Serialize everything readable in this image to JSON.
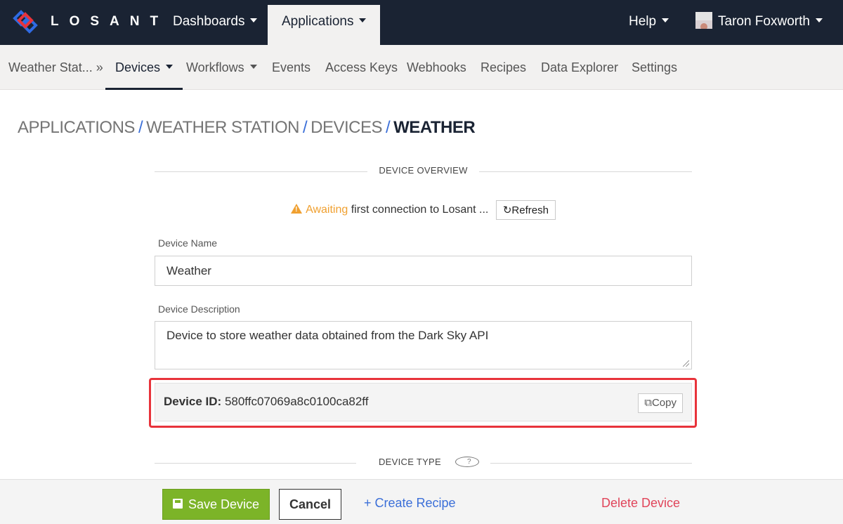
{
  "topbar": {
    "brand": "LOSANT",
    "dashboards": "Dashboards",
    "applications": "Applications",
    "help": "Help",
    "user": "Taron Foxworth"
  },
  "subnav": {
    "app": "Weather Stat... »",
    "devices": "Devices",
    "workflows": "Workflows",
    "events": "Events",
    "access_keys": "Access Keys",
    "webhooks": "Webhooks",
    "recipes": "Recipes",
    "data_explorer": "Data Explorer",
    "settings": "Settings"
  },
  "breadcrumb": {
    "items": [
      "APPLICATIONS",
      "WEATHER STATION",
      "DEVICES"
    ],
    "separator": "/",
    "current": "WEATHER"
  },
  "overview": {
    "heading": "DEVICE OVERVIEW",
    "status_highlight": "Awaiting",
    "status_rest": " first connection to Losant ...",
    "refresh_label": "Refresh"
  },
  "form": {
    "name_label": "Device Name",
    "name_value": "Weather",
    "description_label": "Device Description",
    "description_value": "Device to store weather data obtained from the Dark Sky API",
    "device_id_label": "Device ID:",
    "device_id_value": "580ffc07069a8c0100ca82ff",
    "copy_label": "Copy"
  },
  "device_type": {
    "heading": "DEVICE TYPE",
    "help": "?"
  },
  "footer": {
    "save": "Save Device",
    "cancel": "Cancel",
    "create_recipe": "+ Create Recipe",
    "delete": "Delete Device"
  },
  "colors": {
    "nav_bg": "#1a2333",
    "accent_blue": "#3b6fd8",
    "save_green": "#7cb428",
    "warning_orange": "#f0a030",
    "delete_red": "#e0455a",
    "highlight_red": "#e8333b"
  }
}
